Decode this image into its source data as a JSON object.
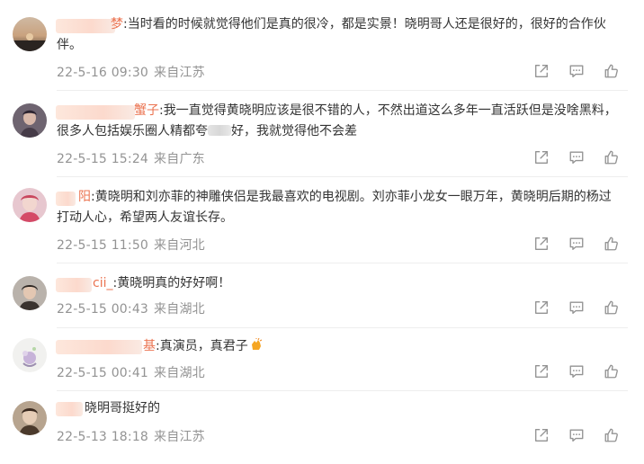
{
  "colors": {
    "nickname": "#eb7350",
    "text": "#333333",
    "meta": "#939393",
    "divider": "#eeeeee",
    "icon": "#939393"
  },
  "icons": {
    "share": "share-icon",
    "comment": "comment-icon",
    "like": "thumbs-up-icon"
  },
  "comments": [
    {
      "nick": "梦",
      "body": ":当时看的时候就觉得他们是真的很冷，都是实景！晓明哥人还是很好的，很好的合作伙伴。",
      "date": "22-5-16 09:30",
      "location": "来自江苏"
    },
    {
      "nick": "蟹子",
      "body_a": ":我一直觉得黄晓明应该是很不错的人，不然出道这么多年一直活跃但是没啥黑料，很多人包括娱乐圈人精都夸",
      "body_b": "好，我就觉得他不会差",
      "date": "22-5-15 15:24",
      "location": "来自广东"
    },
    {
      "nick": "阳",
      "body": ":黄晓明和刘亦菲的神雕侠侣是我最喜欢的电视剧。刘亦菲小龙女一眼万年，黄晓明后期的杨过打动人心，希望两人友谊长存。",
      "date": "22-5-15 11:50",
      "location": "来自河北"
    },
    {
      "nick": "cii_",
      "body": ":黄晓明真的好好啊！",
      "date": "22-5-15 00:43",
      "location": "来自湖北"
    },
    {
      "nick": "基",
      "body": ":真演员，真君子",
      "date": "22-5-15 00:41",
      "location": "来自湖北"
    },
    {
      "nick": "",
      "body": "晓明哥挺好的",
      "date": "22-5-13 18:18",
      "location": "来自江苏"
    }
  ]
}
